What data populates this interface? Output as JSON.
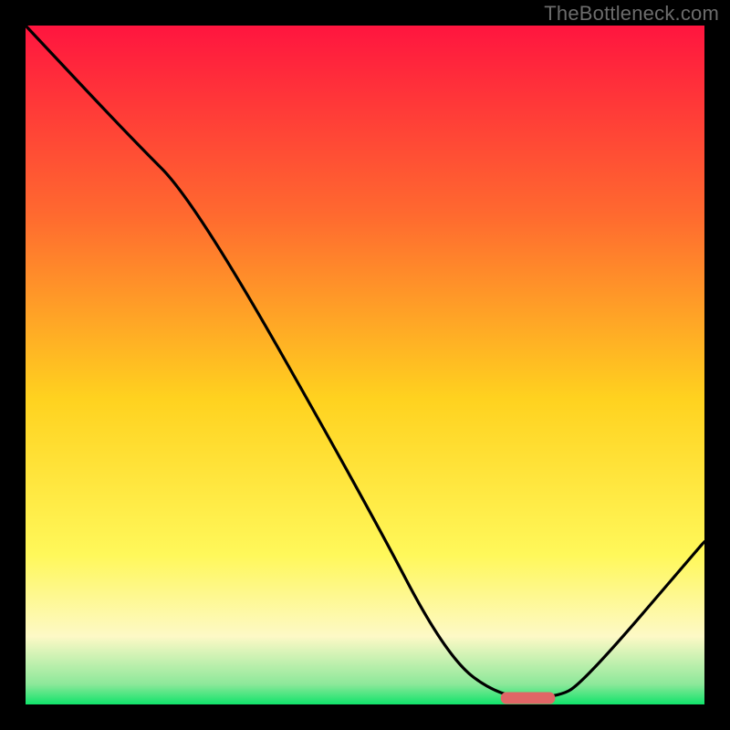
{
  "watermark": "TheBottleneck.com",
  "colors": {
    "frame": "#000000",
    "top": "#ff153f",
    "mid_upper": "#ff7a2f",
    "mid": "#ffd21f",
    "lower": "#fff85a",
    "cream": "#fdf9c6",
    "green": "#10e36a",
    "curve": "#000000",
    "marker": "#e06666"
  },
  "chart_data": {
    "type": "line",
    "title": "",
    "xlabel": "",
    "ylabel": "",
    "xlim": [
      0,
      100
    ],
    "ylim": [
      0,
      100
    ],
    "grid": false,
    "series": [
      {
        "name": "bottleneck-curve",
        "x": [
          0,
          15,
          25,
          50,
          62,
          70,
          78,
          82,
          100
        ],
        "y": [
          100,
          84,
          74,
          30,
          7,
          1,
          1,
          3,
          24
        ]
      }
    ],
    "markers": [
      {
        "name": "optimal-range",
        "x_start": 70,
        "x_end": 78,
        "y": 1
      }
    ],
    "legend": false,
    "annotations": []
  }
}
